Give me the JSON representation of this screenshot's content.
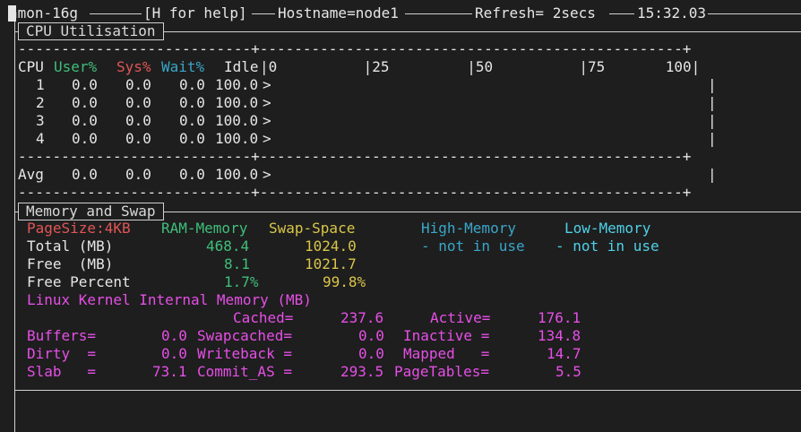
{
  "topbar": {
    "app": "nmon-16g",
    "help": "[H for help]",
    "hostname": "Hostname=node1",
    "refresh": "Refresh= 2secs",
    "time": "15:32.03"
  },
  "cpu_section": {
    "title": "CPU Utilisation",
    "dash_line": "---------------------------+-------------------------------------------------+",
    "header": {
      "cpu": "CPU",
      "user": "User%",
      "sys": "Sys%",
      "wait": "Wait%",
      "idle": "Idle",
      "scale": "|0          |25         |50          |75       100|"
    },
    "rows": [
      {
        "cpu": "1",
        "user": "0.0",
        "sys": "0.0",
        "wait": "0.0",
        "idle": "100.0",
        "bar": ">"
      },
      {
        "cpu": "2",
        "user": "0.0",
        "sys": "0.0",
        "wait": "0.0",
        "idle": "100.0",
        "bar": ">"
      },
      {
        "cpu": "3",
        "user": "0.0",
        "sys": "0.0",
        "wait": "0.0",
        "idle": "100.0",
        "bar": ">"
      },
      {
        "cpu": "4",
        "user": "0.0",
        "sys": "0.0",
        "wait": "0.0",
        "idle": "100.0",
        "bar": ">"
      }
    ],
    "avg": {
      "label": "Avg",
      "user": "0.0",
      "sys": "0.0",
      "wait": "0.0",
      "idle": "100.0",
      "bar": ">"
    }
  },
  "memory_section": {
    "title": "Memory and Swap",
    "pagesize": "PageSize:4KB",
    "col_ram": "RAM-Memory",
    "col_swap": "Swap-Space",
    "col_high": "High-Memory",
    "col_low": "Low-Memory",
    "total_label": "Total (MB)",
    "total_ram": "468.4",
    "total_swap": "1024.0",
    "high_status": "- not in use",
    "low_status": "- not in use",
    "free_label": "Free  (MB)",
    "free_ram": "8.1",
    "free_swap": "1021.7",
    "freepct_label": "Free Percent",
    "freepct_ram": "1.7%",
    "freepct_swap": "99.8%",
    "kernel_title": "Linux Kernel Internal Memory (MB)",
    "kernel": {
      "cached_label": "Cached=",
      "cached": "237.6",
      "active_label": "Active=",
      "active": "176.1",
      "buffers_label": "Buffers=",
      "buffers": "0.0",
      "swapcached_label": "Swapcached=",
      "swapcached": "0.0",
      "inactive_label": "Inactive =",
      "inactive": "134.8",
      "dirty_label": "Dirty  =",
      "dirty": "0.0",
      "writeback_label": "Writeback =",
      "writeback": "0.0",
      "mapped_label": "Mapped   =",
      "mapped": "14.7",
      "slab_label": "Slab   =",
      "slab": "73.1",
      "commit_label": "Commit_AS =",
      "commit": "293.5",
      "pagetables_label": "PageTables=",
      "pagetables": "5.5"
    }
  }
}
